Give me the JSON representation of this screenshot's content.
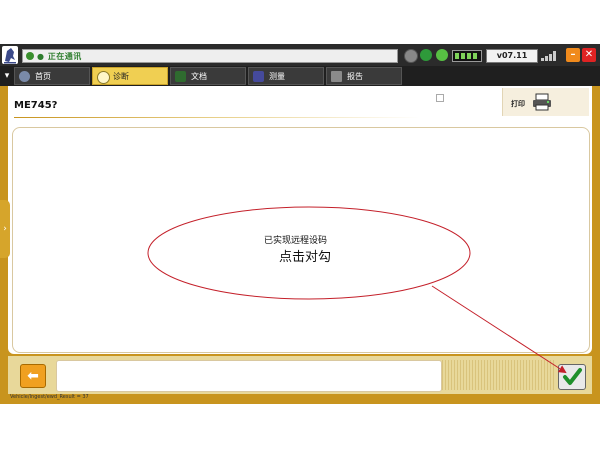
{
  "header": {
    "title_text": "● 正在通讯",
    "version": "v07.11"
  },
  "tabs": [
    {
      "label": "首页"
    },
    {
      "label": "诊断"
    },
    {
      "label": "文档"
    },
    {
      "label": "测量"
    },
    {
      "label": "报告"
    }
  ],
  "page": {
    "title": "ME745?",
    "print_label": "打印"
  },
  "annotation": {
    "line1": "已实现远程设码",
    "line2": "点击对勾"
  },
  "status": {
    "text": "Vehicle/Ingest/ewd_Result = 37"
  },
  "colors": {
    "frame": "#c8941e",
    "active_tab": "#f0cf52",
    "annotation": "#c4202a"
  },
  "icons": {
    "back": "arrow-left-icon",
    "confirm": "checkmark-icon",
    "print": "printer-icon"
  }
}
